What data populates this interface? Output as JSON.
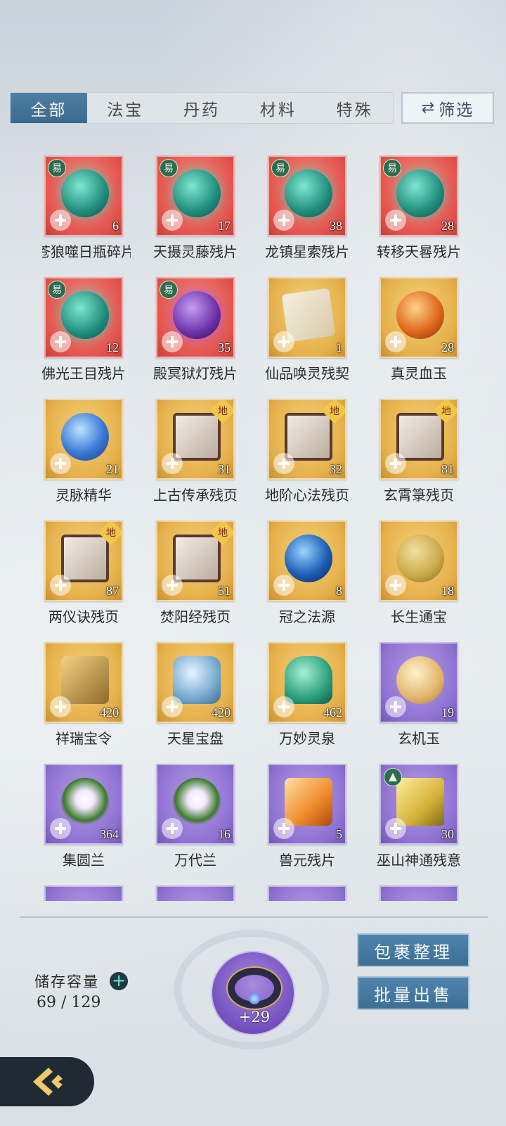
{
  "tabs": [
    {
      "label": "全部",
      "active": true
    },
    {
      "label": "法宝",
      "active": false
    },
    {
      "label": "丹药",
      "active": false
    },
    {
      "label": "材料",
      "active": false
    },
    {
      "label": "特殊",
      "active": false
    }
  ],
  "filter": {
    "icon": "swap-arrows-icon",
    "label": "筛选"
  },
  "items": [
    {
      "name": "苍狼噬日瓶碎片",
      "display": "苍狼噬日瓶碎片",
      "count": "6",
      "rarity": "red",
      "badge": "易",
      "art": "red-orb"
    },
    {
      "name": "天摄灵藤残片",
      "display": "天摄灵藤残片",
      "count": "17",
      "rarity": "red",
      "badge": "易",
      "art": "red-orb"
    },
    {
      "name": "龙镇星索残片",
      "display": "龙镇星索残片",
      "count": "38",
      "rarity": "red",
      "badge": "易",
      "art": "red-orb"
    },
    {
      "name": "转移天晷残片",
      "display": "转移天晷残片",
      "count": "28",
      "rarity": "red",
      "badge": "易",
      "art": "red-orb"
    },
    {
      "name": "佛光王目残片",
      "display": "佛光王目残片",
      "count": "12",
      "rarity": "red",
      "badge": "易",
      "art": "red-orb"
    },
    {
      "name": "殿冥狱灯残片",
      "display": "殿冥狱灯残片",
      "count": "35",
      "rarity": "red",
      "badge": "易",
      "art": "purple-orb"
    },
    {
      "name": "仙品唤灵残契",
      "display": "仙品唤灵残契",
      "count": "1",
      "rarity": "gold",
      "badge": "",
      "art": "scroll"
    },
    {
      "name": "真灵血玉",
      "display": "真灵血玉",
      "count": "28",
      "rarity": "gold",
      "badge": "",
      "art": "blood"
    },
    {
      "name": "灵脉精华",
      "display": "灵脉精华",
      "count": "21",
      "rarity": "gold",
      "badge": "",
      "art": "spirit"
    },
    {
      "name": "上古传承残页",
      "display": "上古传承残页",
      "count": "31",
      "rarity": "gold",
      "badge": "地",
      "art": "book"
    },
    {
      "name": "地阶心法残页",
      "display": "地阶心法残页",
      "count": "32",
      "rarity": "gold",
      "badge": "地",
      "art": "book"
    },
    {
      "name": "玄霄箓残页",
      "display": "玄霄箓残页",
      "count": "81",
      "rarity": "gold",
      "badge": "地",
      "art": "book"
    },
    {
      "name": "两仪诀残页",
      "display": "两仪诀残页",
      "count": "87",
      "rarity": "gold",
      "badge": "地",
      "art": "book"
    },
    {
      "name": "焚阳经残页",
      "display": "焚阳经残页",
      "count": "51",
      "rarity": "gold",
      "badge": "地",
      "art": "book"
    },
    {
      "name": "冠之法源",
      "display": "冠之法源",
      "count": "8",
      "rarity": "gold",
      "badge": "",
      "art": "blue-orb"
    },
    {
      "name": "长生通宝",
      "display": "长生通宝",
      "count": "18",
      "rarity": "gold",
      "badge": "",
      "art": "coin"
    },
    {
      "name": "祥瑞宝令",
      "display": "祥瑞宝令",
      "count": "420",
      "rarity": "gold",
      "badge": "",
      "art": "token"
    },
    {
      "name": "天星宝盘",
      "display": "天星宝盘",
      "count": "420",
      "rarity": "gold",
      "badge": "",
      "art": "plate"
    },
    {
      "name": "万妙灵泉",
      "display": "万妙灵泉",
      "count": "462",
      "rarity": "gold",
      "badge": "",
      "art": "vase"
    },
    {
      "name": "玄机玉",
      "display": "玄机玉",
      "count": "19",
      "rarity": "purple",
      "badge": "",
      "art": "jade"
    },
    {
      "name": "集圆兰",
      "display": "集圆兰",
      "count": "364",
      "rarity": "purple",
      "badge": "",
      "art": "orchid"
    },
    {
      "name": "万代兰",
      "display": "万代兰",
      "count": "16",
      "rarity": "purple",
      "badge": "",
      "art": "orchid"
    },
    {
      "name": "兽元残片",
      "display": "兽元残片",
      "count": "5",
      "rarity": "purple",
      "badge": "",
      "art": "shards"
    },
    {
      "name": "巫山神通残意",
      "display": "巫山神通残意",
      "count": "30",
      "rarity": "purple",
      "badge": "tri",
      "art": "relic"
    }
  ],
  "partial_row_rarities": [
    "purple",
    "purple",
    "purple",
    "purple"
  ],
  "storage": {
    "label": "储存容量",
    "current": 69,
    "max": 129,
    "display": "69 / 129"
  },
  "equipped": {
    "count": "+29",
    "icon": "ring-icon"
  },
  "actions": {
    "organize": "包裹整理",
    "bulk_sell": "批量出售"
  },
  "colors": {
    "tab_active": "#3d6a8f",
    "red_tile": "#e4564f",
    "gold_tile": "#e5b04a",
    "purple_tile": "#8f72d1"
  }
}
